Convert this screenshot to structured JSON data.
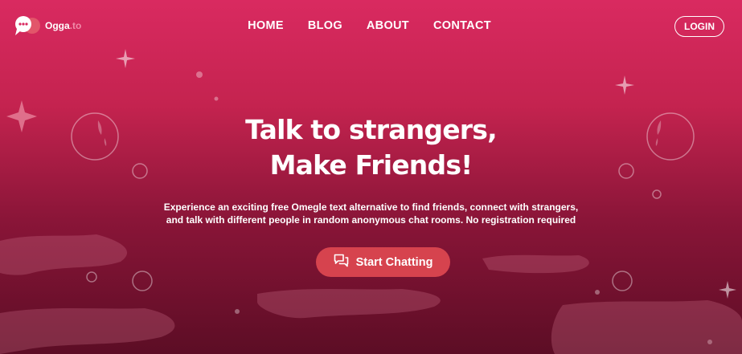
{
  "brand": {
    "name": "Ogga",
    "tld": ".to"
  },
  "nav": {
    "items": [
      "HOME",
      "BLOG",
      "ABOUT",
      "CONTACT"
    ],
    "login": "LOGIN"
  },
  "hero": {
    "title_line1": "Talk to strangers,",
    "title_line2": "Make Friends!",
    "subtitle_line1": "Experience an exciting free Omegle text alternative to find friends, connect with strangers,",
    "subtitle_line2": "and talk with different people in random anonymous chat rooms. No registration required",
    "cta_label": "Start Chatting",
    "cta_icon": "chat-bubbles-icon"
  },
  "colors": {
    "background_top": "#d92a60",
    "background_bottom": "#5c0d25",
    "cta": "#d6434e"
  }
}
